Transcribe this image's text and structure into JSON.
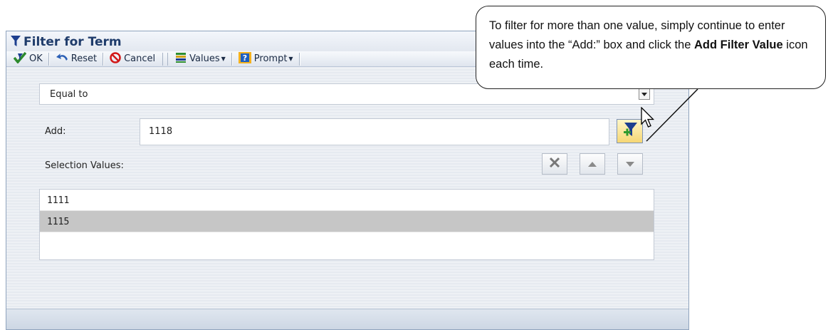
{
  "dialog": {
    "title": "Filter for Term"
  },
  "toolbar": {
    "ok_label": "OK",
    "reset_label": "Reset",
    "cancel_label": "Cancel",
    "values_label": "Values",
    "prompt_label": "Prompt"
  },
  "filter": {
    "operator": "Equal to",
    "add_label": "Add:",
    "add_value": "1118",
    "selection_label": "Selection Values:",
    "selection_values": [
      "1111",
      "1115"
    ],
    "selected_index": 1
  },
  "callout": {
    "text_before": "To filter for more than one value, simply continue to enter values into the “Add:” box and click the ",
    "bold_text": "Add Filter Value",
    "text_after": " icon each time."
  },
  "colors": {
    "title_text": "#1f3c6b",
    "selected_row": "#c6c6c6",
    "add_button": "#f6d774"
  },
  "icons": {
    "title": "filter-funnel-icon",
    "ok": "checkmark-icon",
    "reset": "reset-arrow-icon",
    "cancel": "no-entry-icon",
    "values": "values-list-icon",
    "prompt": "question-icon",
    "add_filter": "add-filter-value-icon",
    "delete": "delete-x-icon",
    "move_up": "move-up-icon",
    "move_down": "move-down-icon"
  }
}
